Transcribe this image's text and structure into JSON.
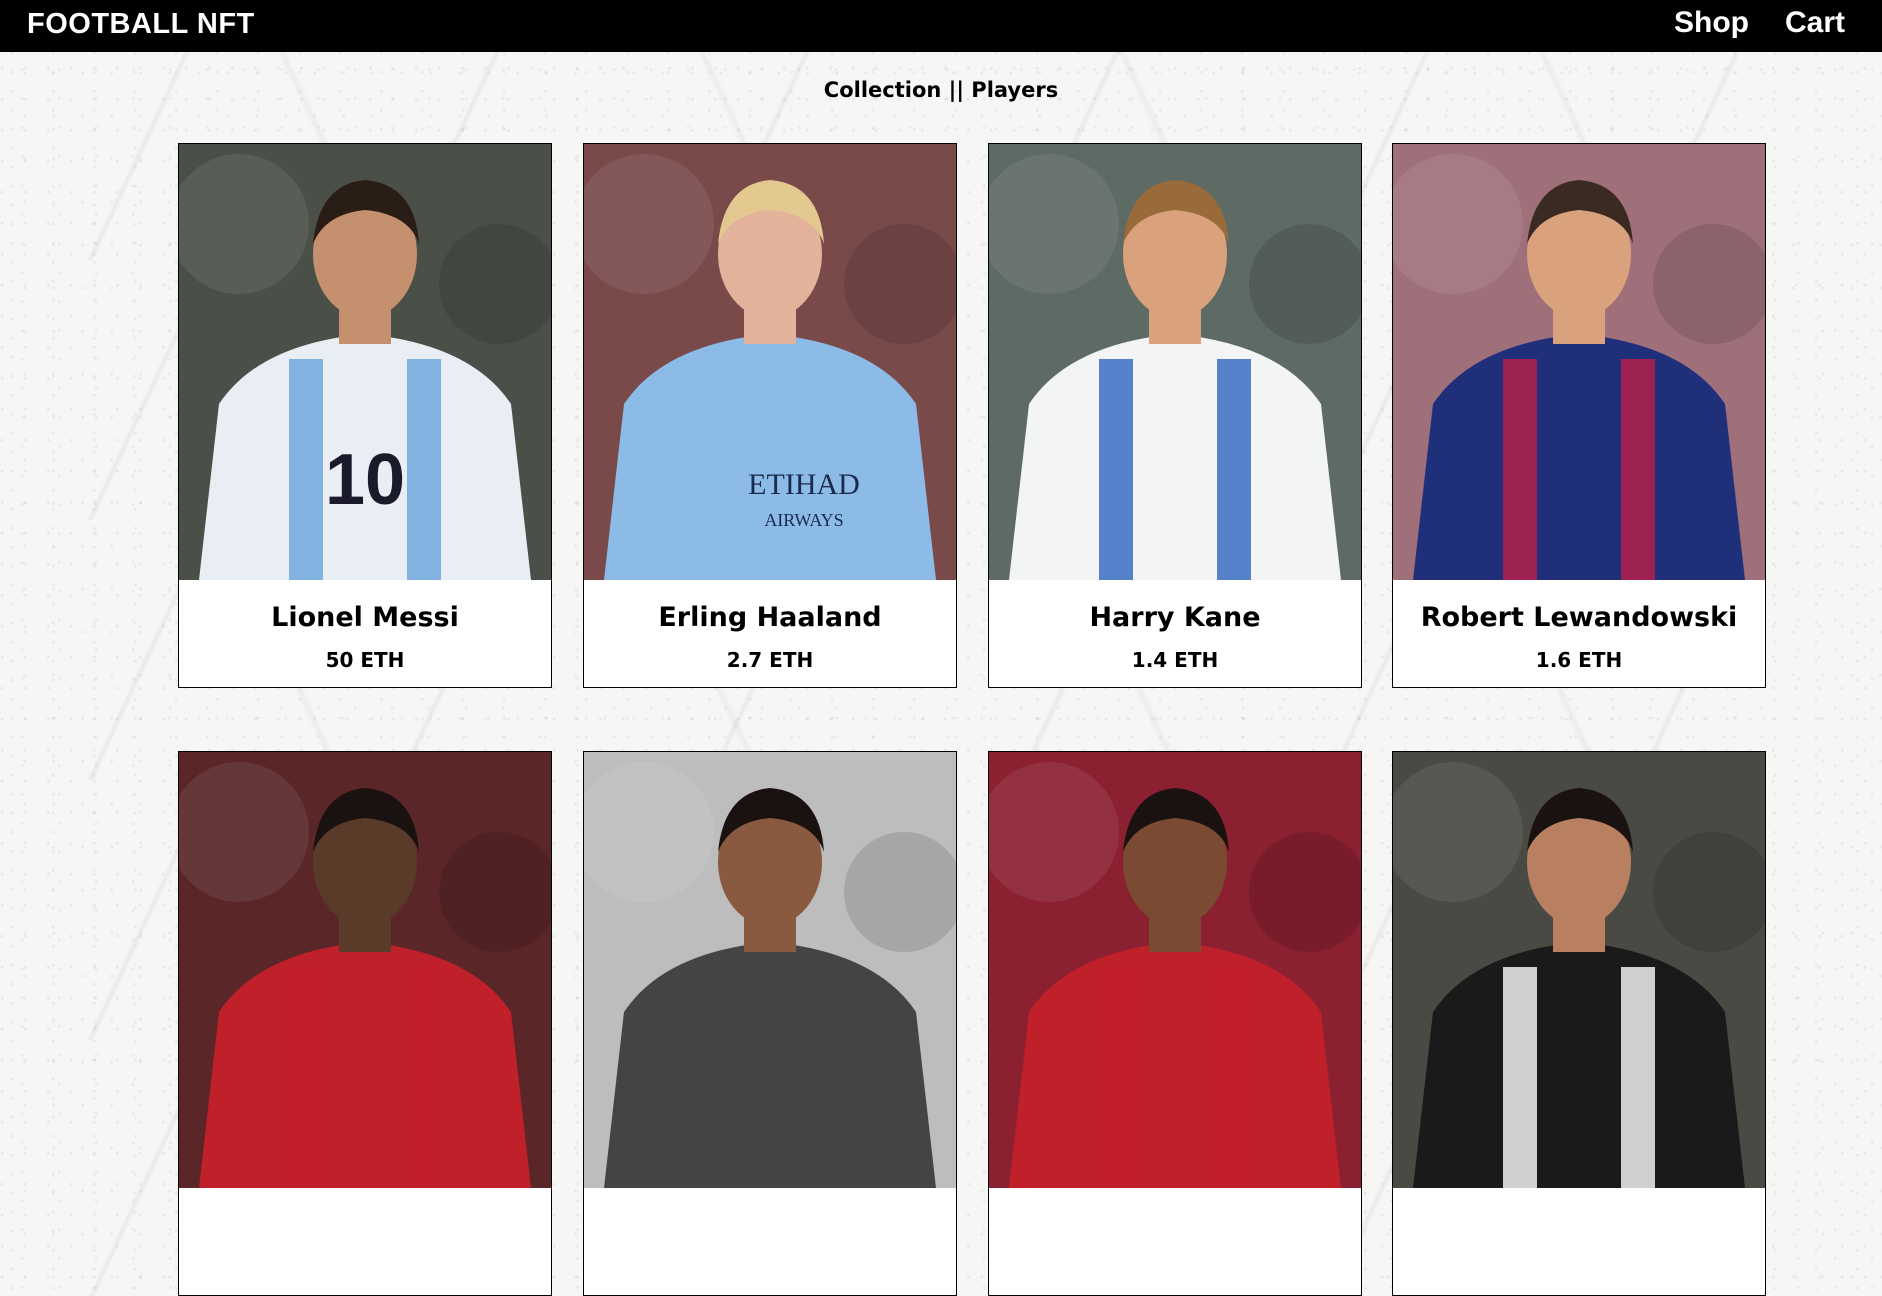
{
  "nav": {
    "brand": "FOOTBALL NFT",
    "shop_label": "Shop",
    "cart_label": "Cart"
  },
  "page": {
    "title": "Collection || Players"
  },
  "players": [
    {
      "name": "Lionel Messi",
      "price": "50 ETH",
      "shirt_number": "10",
      "bg": "#4a5048",
      "shirt": "#e9eef5",
      "stripe": "#6fa7dc",
      "skin": "#c4906e",
      "hair": "#2a1d16"
    },
    {
      "name": "Erling Haaland",
      "price": "2.7 ETH",
      "sponsor_line1": "ETIHAD",
      "sponsor_line2": "AIRWAYS",
      "bg": "#7a4a4a",
      "shirt": "#8cbbe8",
      "stripe": "#8cbbe8",
      "skin": "#e2b29a",
      "hair": "#e3c98f"
    },
    {
      "name": "Harry Kane",
      "price": "1.4 ETH",
      "bg": "#5e6a64",
      "shirt": "#f2f4f6",
      "stripe": "#3a6cc2",
      "skin": "#d9a27c",
      "hair": "#9a6b3a"
    },
    {
      "name": "Robert Lewandowski",
      "price": "1.6 ETH",
      "bg": "#a0707a",
      "shirt": "#1f2f7a",
      "stripe": "#b5204a",
      "skin": "#d9a27c",
      "hair": "#3a2a22"
    },
    {
      "name": "",
      "price": "",
      "bg": "#5a2628",
      "shirt": "#c0202a",
      "stripe": "#c0202a",
      "skin": "#5a3a28",
      "hair": "#1a1210"
    },
    {
      "name": "",
      "price": "",
      "bg": "#bdbdbd",
      "shirt": "#444444",
      "stripe": "#444444",
      "skin": "#8a5a40",
      "hair": "#1a1210"
    },
    {
      "name": "",
      "price": "",
      "bg": "#8a2030",
      "shirt": "#c0202a",
      "stripe": "#c0202a",
      "skin": "#7a4a32",
      "hair": "#1a1210"
    },
    {
      "name": "",
      "price": "",
      "bg": "#4a4a44",
      "shirt": "#1a1a1a",
      "stripe": "#f0f0f0",
      "skin": "#b88060",
      "hair": "#1a1210"
    }
  ]
}
